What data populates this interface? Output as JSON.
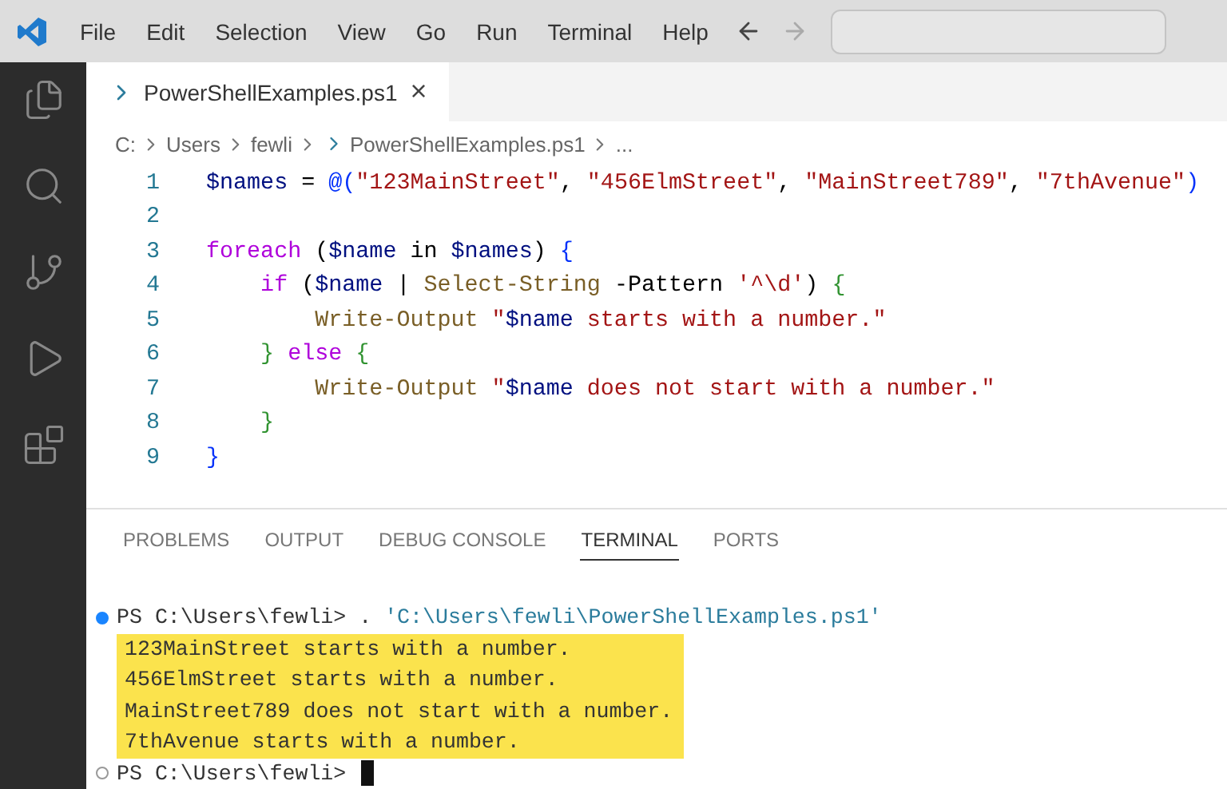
{
  "menu": [
    "File",
    "Edit",
    "Selection",
    "View",
    "Go",
    "Run",
    "Terminal",
    "Help"
  ],
  "tabs": [
    {
      "label": "PowerShellExamples.ps1",
      "selected": true,
      "close": "×"
    }
  ],
  "breadcrumbs": [
    {
      "text": "C:",
      "file": false
    },
    {
      "text": "Users",
      "file": false
    },
    {
      "text": "fewli",
      "file": false
    },
    {
      "text": "PowerShellExamples.ps1",
      "file": true
    },
    {
      "text": "...",
      "file": false
    }
  ],
  "code": [
    {
      "number": "1",
      "tokens": [
        {
          "text": "$names",
          "kind": "var"
        },
        {
          "text": " = ",
          "kind": "plain"
        },
        {
          "text": "@(",
          "kind": "bracket"
        },
        {
          "text": "\"123MainStreet\"",
          "kind": "str"
        },
        {
          "text": ", ",
          "kind": "plain"
        },
        {
          "text": "\"456ElmStreet\"",
          "kind": "str"
        },
        {
          "text": ", ",
          "kind": "plain"
        },
        {
          "text": "\"MainStreet789\"",
          "kind": "str"
        },
        {
          "text": ", ",
          "kind": "plain"
        },
        {
          "text": "\"7thAvenue\"",
          "kind": "str"
        },
        {
          "text": ")",
          "kind": "bracket"
        }
      ]
    },
    {
      "number": "2"
    },
    {
      "number": "3",
      "tokens": [
        {
          "text": "foreach",
          "kind": "kw"
        },
        {
          "text": " (",
          "kind": "plain"
        },
        {
          "text": "$name",
          "kind": "var"
        },
        {
          "text": " in ",
          "kind": "plain"
        },
        {
          "text": "$names",
          "kind": "var"
        },
        {
          "text": ") ",
          "kind": "plain"
        },
        {
          "text": "{",
          "kind": "bracket"
        }
      ]
    },
    {
      "number": "4",
      "tokens": [
        {
          "text": "    if",
          "kind": "kw"
        },
        {
          "text": " (",
          "kind": "plain"
        },
        {
          "text": "$name",
          "kind": "var"
        },
        {
          "text": " | ",
          "kind": "plain"
        },
        {
          "text": "Select-String",
          "kind": "cmd"
        },
        {
          "text": " -Pattern ",
          "kind": "plain"
        },
        {
          "text": "'^\\d'",
          "kind": "str"
        },
        {
          "text": ") ",
          "kind": "plain"
        },
        {
          "text": "{",
          "kind": "bracket2"
        }
      ]
    },
    {
      "number": "5",
      "tokens": [
        {
          "text": "        Write-Output",
          "kind": "cmd"
        },
        {
          "text": " \"",
          "kind": "str"
        },
        {
          "text": "$name",
          "kind": "var"
        },
        {
          "text": " starts with a number.\"",
          "kind": "str"
        }
      ]
    },
    {
      "number": "6",
      "tokens": [
        {
          "text": "    }",
          "kind": "bracket2"
        },
        {
          "text": " else ",
          "kind": "kw"
        },
        {
          "text": "{",
          "kind": "bracket2"
        }
      ]
    },
    {
      "number": "7",
      "tokens": [
        {
          "text": "        Write-Output",
          "kind": "cmd"
        },
        {
          "text": " \"",
          "kind": "str"
        },
        {
          "text": "$name",
          "kind": "var"
        },
        {
          "text": " does not start with a number.\"",
          "kind": "str"
        }
      ]
    },
    {
      "number": "8",
      "tokens": [
        {
          "text": "    }",
          "kind": "bracket2"
        }
      ]
    },
    {
      "number": "9",
      "tokens": [
        {
          "text": "}",
          "kind": "bracket"
        }
      ]
    }
  ],
  "panel_tabs": [
    {
      "label": "PROBLEMS",
      "selected": false
    },
    {
      "label": "OUTPUT",
      "selected": false
    },
    {
      "label": "DEBUG CONSOLE",
      "selected": false
    },
    {
      "label": "TERMINAL",
      "selected": true
    },
    {
      "label": "PORTS",
      "selected": false
    }
  ],
  "terminal": [
    {
      "kind": "command",
      "success": true,
      "prompt": "PS C:\\Users\\fewli> ",
      "command": ". ",
      "argument": "'C:\\Users\\fewli\\PowerShellExamples.ps1'"
    },
    {
      "kind": "output",
      "text": "123MainStreet starts with a number.",
      "highlighted": true
    },
    {
      "kind": "output",
      "text": "456ElmStreet starts with a number.",
      "highlighted": true
    },
    {
      "kind": "output",
      "text": "MainStreet789 does not start with a number.",
      "highlighted": true
    },
    {
      "kind": "output",
      "text": "7thAvenue starts with a number.",
      "highlighted": true
    },
    {
      "kind": "prompt",
      "success": false,
      "prompt": "PS C:\\Users\\fewli>"
    }
  ]
}
